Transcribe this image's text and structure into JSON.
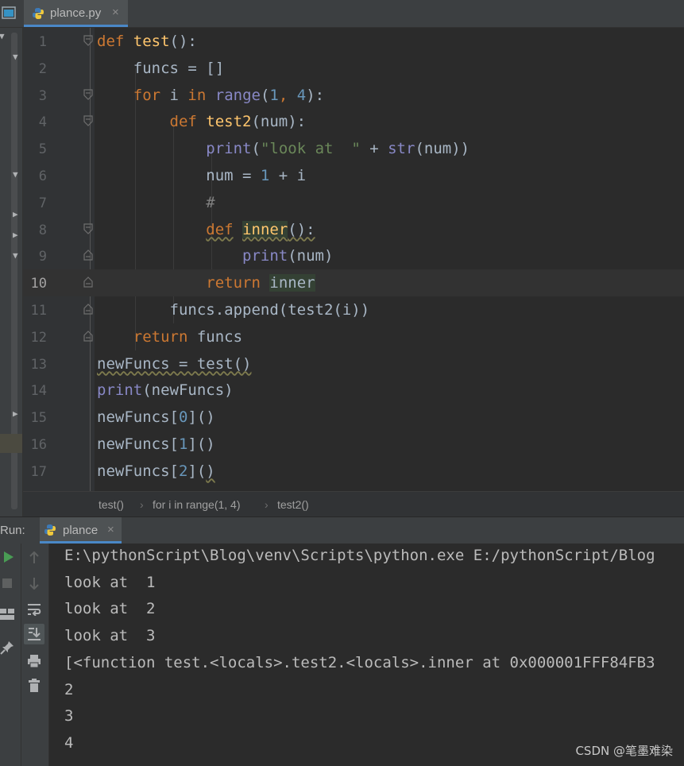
{
  "editor_tab": {
    "filename": "plance.py",
    "close": "×"
  },
  "code": {
    "current_line": 10,
    "lines": [
      {
        "n": "1",
        "tokens": [
          {
            "t": "def ",
            "c": "kw"
          },
          {
            "t": "test",
            "c": "fn"
          },
          {
            "t": "():",
            "c": ""
          }
        ]
      },
      {
        "n": "2",
        "tokens": [
          {
            "t": "    funcs = []",
            "c": ""
          }
        ]
      },
      {
        "n": "3",
        "tokens": [
          {
            "t": "    ",
            "c": ""
          },
          {
            "t": "for",
            "c": "kw"
          },
          {
            "t": " i ",
            "c": ""
          },
          {
            "t": "in",
            "c": "kw"
          },
          {
            "t": " ",
            "c": ""
          },
          {
            "t": "range",
            "c": "bi"
          },
          {
            "t": "(",
            "c": ""
          },
          {
            "t": "1",
            "c": "num"
          },
          {
            "t": ", ",
            "c": "kw"
          },
          {
            "t": "4",
            "c": "num"
          },
          {
            "t": "):",
            "c": ""
          }
        ]
      },
      {
        "n": "4",
        "tokens": [
          {
            "t": "        ",
            "c": ""
          },
          {
            "t": "def ",
            "c": "kw"
          },
          {
            "t": "test2",
            "c": "fn"
          },
          {
            "t": "(num):",
            "c": ""
          }
        ]
      },
      {
        "n": "5",
        "tokens": [
          {
            "t": "            ",
            "c": ""
          },
          {
            "t": "print",
            "c": "bi"
          },
          {
            "t": "(",
            "c": ""
          },
          {
            "t": "\"look at  \"",
            "c": "str"
          },
          {
            "t": " + ",
            "c": ""
          },
          {
            "t": "str",
            "c": "bi"
          },
          {
            "t": "(num))",
            "c": ""
          }
        ]
      },
      {
        "n": "6",
        "tokens": [
          {
            "t": "            num = ",
            "c": ""
          },
          {
            "t": "1",
            "c": "num"
          },
          {
            "t": " + i",
            "c": ""
          }
        ]
      },
      {
        "n": "7",
        "tokens": [
          {
            "t": "            ",
            "c": ""
          },
          {
            "t": "#",
            "c": "cmt"
          }
        ]
      },
      {
        "n": "8",
        "tokens": [
          {
            "t": "            ",
            "c": ""
          },
          {
            "t": "def",
            "c": "kw wavy"
          },
          {
            "t": " ",
            "c": ""
          },
          {
            "t": "inner",
            "c": "fn hl wavy"
          },
          {
            "t": "():",
            "c": "wavy"
          }
        ]
      },
      {
        "n": "9",
        "tokens": [
          {
            "t": "                ",
            "c": ""
          },
          {
            "t": "print",
            "c": "bi"
          },
          {
            "t": "(num)",
            "c": ""
          }
        ]
      },
      {
        "n": "10",
        "tokens": [
          {
            "t": "            ",
            "c": ""
          },
          {
            "t": "return",
            "c": "kw"
          },
          {
            "t": " ",
            "c": ""
          },
          {
            "t": "inner",
            "c": "hl"
          }
        ]
      },
      {
        "n": "11",
        "tokens": [
          {
            "t": "        funcs.append(test2(i))",
            "c": ""
          }
        ]
      },
      {
        "n": "12",
        "tokens": [
          {
            "t": "    ",
            "c": ""
          },
          {
            "t": "return",
            "c": "kw"
          },
          {
            "t": " funcs",
            "c": ""
          }
        ]
      },
      {
        "n": "13",
        "tokens": [
          {
            "t": "newFuncs = test()",
            "c": "wavy"
          }
        ]
      },
      {
        "n": "14",
        "tokens": [
          {
            "t": "print",
            "c": "bi"
          },
          {
            "t": "(newFuncs)",
            "c": ""
          }
        ]
      },
      {
        "n": "15",
        "tokens": [
          {
            "t": "newFuncs[",
            "c": ""
          },
          {
            "t": "0",
            "c": "num"
          },
          {
            "t": "]()",
            "c": ""
          }
        ]
      },
      {
        "n": "16",
        "tokens": [
          {
            "t": "newFuncs[",
            "c": ""
          },
          {
            "t": "1",
            "c": "num"
          },
          {
            "t": "]()",
            "c": ""
          }
        ]
      },
      {
        "n": "17",
        "tokens": [
          {
            "t": "newFuncs[",
            "c": ""
          },
          {
            "t": "2",
            "c": "num"
          },
          {
            "t": "](",
            "c": ""
          },
          {
            "t": ")",
            "c": "wavy"
          }
        ]
      }
    ]
  },
  "breadcrumb": [
    "test()",
    "for i in range(1, 4)",
    "test2()"
  ],
  "breadcrumb_sep": "›",
  "run_panel": {
    "label": "Run:",
    "tab": "plance",
    "close": "×",
    "output": [
      "E:\\pythonScript\\Blog\\venv\\Scripts\\python.exe E:/pythonScript/Blog",
      "look at  1",
      "look at  2",
      "look at  3",
      "[<function test.<locals>.test2.<locals>.inner at 0x000001FFF84FB3",
      "2",
      "3",
      "4"
    ]
  },
  "watermark": "CSDN @笔墨难染",
  "colors": {
    "keyword": "#cc7832",
    "function": "#ffc66d",
    "builtin": "#8888c6",
    "number": "#6897bb",
    "string": "#6a8759",
    "text": "#a9b7c6",
    "accent": "#4a88c7"
  },
  "icons": {
    "project": "project-window-icon",
    "python": "python-file-icon",
    "run": "run-icon",
    "stop": "stop-icon",
    "layout": "layout-icon",
    "pin": "pin-icon",
    "up": "arrow-up-icon",
    "down": "arrow-down-icon",
    "wrap": "soft-wrap-icon",
    "scroll_end": "scroll-to-end-icon",
    "print": "print-icon",
    "trash": "trash-icon"
  }
}
